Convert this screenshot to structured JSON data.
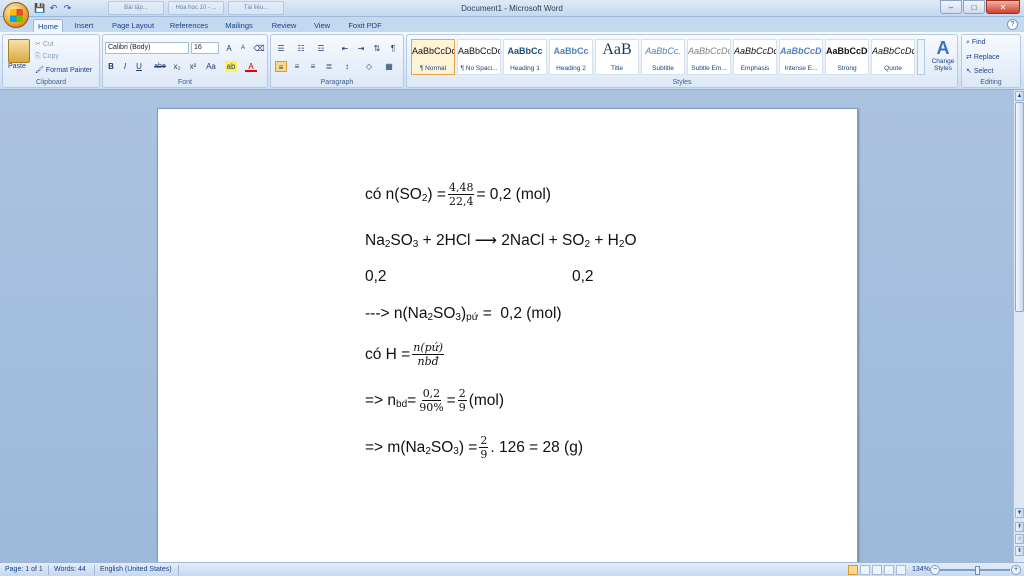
{
  "window": {
    "title": "Document1 - Microsoft Word",
    "help": "?",
    "minimize": "–",
    "maximize": "□",
    "close": "✕",
    "background_tabs": [
      "Bài tập...",
      "Hóa học 10 - ...",
      "Tài liệu..."
    ]
  },
  "qat": {
    "save": "💾",
    "undo": "↶",
    "redo": "↷"
  },
  "tabs": [
    "Home",
    "Insert",
    "Page Layout",
    "References",
    "Mailings",
    "Review",
    "View",
    "Foxit PDF"
  ],
  "active_tab": "Home",
  "clipboard": {
    "paste": "Paste",
    "cut": "Cut",
    "copy": "Copy",
    "format_painter": "Format Painter",
    "label": "Clipboard"
  },
  "font": {
    "name": "Calibri (Body)",
    "size": "16",
    "label": "Font",
    "grow": "A",
    "shrink": "A",
    "clear": "⌫",
    "bold": "B",
    "italic": "I",
    "underline": "U",
    "strike": "abe",
    "subscript": "x₂",
    "superscript": "x²",
    "change_case": "Aa",
    "highlight": "ab",
    "color": "A"
  },
  "paragraph": {
    "label": "Paragraph"
  },
  "styles": {
    "label": "Styles",
    "items": [
      {
        "sample": "AaBbCcDc",
        "name": "¶ Normal"
      },
      {
        "sample": "AaBbCcDc",
        "name": "¶ No Spaci..."
      },
      {
        "sample": "AaBbCc",
        "name": "Heading 1"
      },
      {
        "sample": "AaBbCc",
        "name": "Heading 2"
      },
      {
        "sample": "AaB",
        "name": "Title"
      },
      {
        "sample": "AaBbCc.",
        "name": "Subtitle"
      },
      {
        "sample": "AaBbCcDc",
        "name": "Subtle Em..."
      },
      {
        "sample": "AaBbCcDc",
        "name": "Emphasis"
      },
      {
        "sample": "AaBbCcDc",
        "name": "Intense E..."
      },
      {
        "sample": "AaBbCcDc",
        "name": "Strong"
      },
      {
        "sample": "AaBbCcDc",
        "name": "Quote"
      }
    ],
    "change_styles": "Change Styles"
  },
  "editing": {
    "find": "Find",
    "replace": "Replace",
    "select": "Select",
    "label": "Editing"
  },
  "doc": {
    "l1_a": "có n(SO",
    "l1_sub": "2",
    "l1_b": ") =",
    "l1_num": "4,48",
    "l1_den": "22,4",
    "l1_c": "= 0,2 (mol)",
    "l2_a": "Na",
    "l2_s1": "2",
    "l2_b": "SO",
    "l2_s2": "3",
    "l2_c": " + 2HCl ⟶ 2NaCl + SO",
    "l2_s3": "2",
    "l2_d": " + H",
    "l2_s4": "2",
    "l2_e": "O",
    "l3_a": "0,2",
    "l3_b": "0,2",
    "l4_a": "---> n(Na",
    "l4_s1": "2",
    "l4_b": "SO",
    "l4_s2": "3",
    "l4_c": ")",
    "l4_s3": "pứ",
    "l4_d": " =  0,2 (mol)",
    "l5_a": "có H =",
    "l5_num": "n(pứ)",
    "l5_den": "nbđ",
    "l6_a": "=> n",
    "l6_s1": "bd",
    "l6_b": " =",
    "l6_num": "0,2",
    "l6_den": "90%",
    "l6_c": "=",
    "l6_num2": "2",
    "l6_den2": "9",
    "l6_d": "(mol)",
    "l7_a": "=> m(Na",
    "l7_s1": "2",
    "l7_b": "SO",
    "l7_s2": "3",
    "l7_c": ") =",
    "l7_num": "2",
    "l7_den": "9",
    "l7_d": ". 126 = 28 (g)"
  },
  "status": {
    "page": "Page: 1 of 1",
    "words": "Words: 44",
    "language": "English (United States)",
    "zoom": "134%",
    "zoom_minus": "−",
    "zoom_plus": "+"
  },
  "scroll": {
    "up": "▲",
    "down": "▼"
  }
}
